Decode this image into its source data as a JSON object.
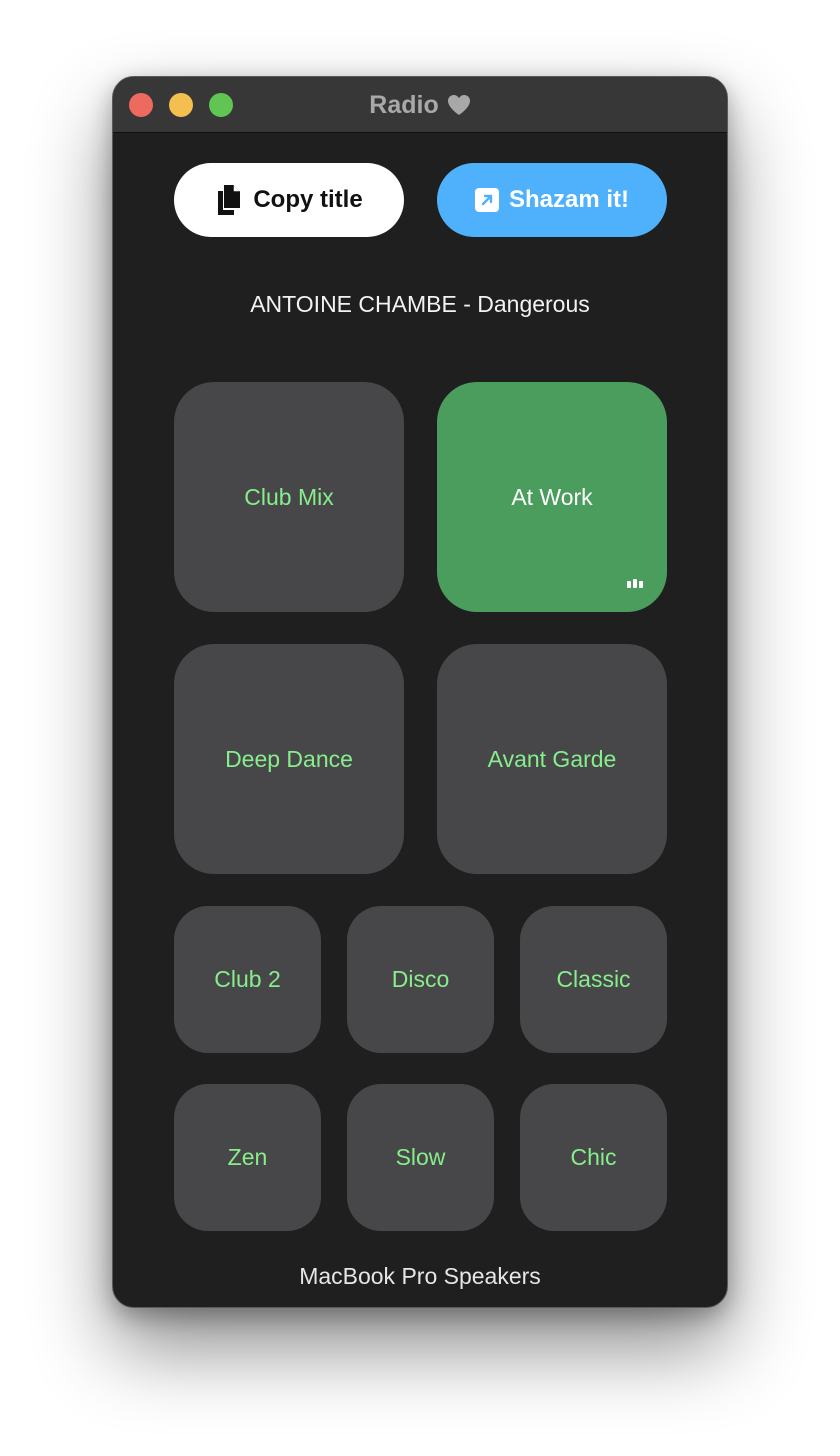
{
  "window": {
    "title": "Radio"
  },
  "buttons": {
    "copy_label": "Copy title",
    "shazam_label": "Shazam it!"
  },
  "now_playing": "ANTOINE CHAMBE - Dangerous",
  "stations": [
    {
      "label": "Club Mix",
      "active": false
    },
    {
      "label": "At Work",
      "active": true
    },
    {
      "label": "Deep Dance",
      "active": false
    },
    {
      "label": "Avant Garde",
      "active": false
    },
    {
      "label": "Club 2",
      "active": false
    },
    {
      "label": "Disco",
      "active": false
    },
    {
      "label": "Classic",
      "active": false
    },
    {
      "label": "Zen",
      "active": false
    },
    {
      "label": "Slow",
      "active": false
    },
    {
      "label": "Chic",
      "active": false
    }
  ],
  "output_device": "MacBook Pro Speakers",
  "icons": {
    "title": "heart-icon",
    "copy": "document-copy-icon",
    "shazam": "arrow-up-right-square-icon",
    "playing": "equalizer-bars-icon"
  },
  "colors": {
    "accent_green": "#86ee8a",
    "active_tile": "#4a9d5c",
    "shazam_blue": "#4fb0fb",
    "tile_gray": "#474749",
    "window_bg": "#1f1f1f"
  }
}
